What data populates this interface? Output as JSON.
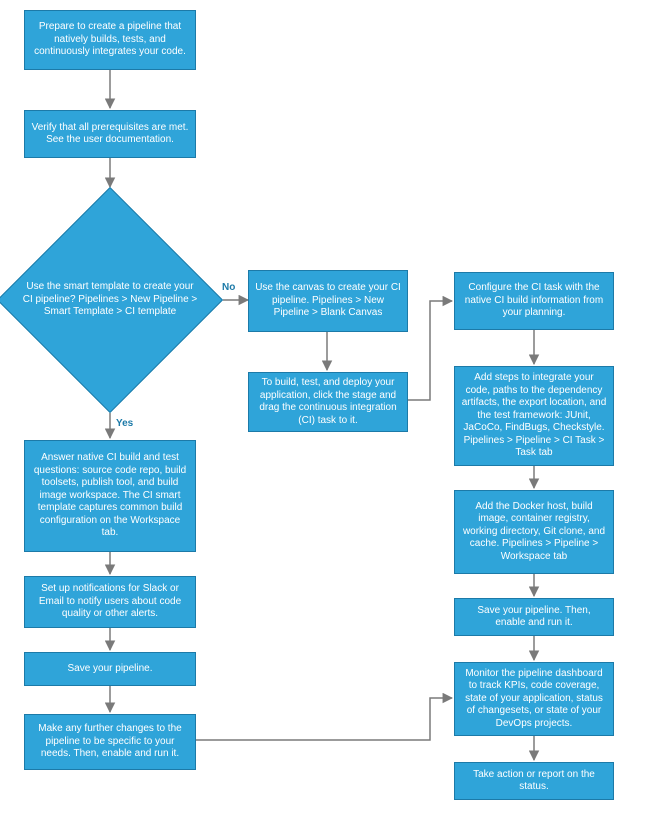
{
  "chart_data": {
    "type": "flowchart",
    "title": "",
    "nodes": [
      {
        "id": "prepare",
        "shape": "rect",
        "text": "Prepare to create a pipeline that natively builds, tests, and continuously integrates your code."
      },
      {
        "id": "verify",
        "shape": "rect",
        "text": "Verify that all prerequisites are met. See the user documentation."
      },
      {
        "id": "decision",
        "shape": "diamond",
        "text": "Use the smart template to create your CI pipeline? Pipelines > New Pipeline > Smart Template > CI template"
      },
      {
        "id": "answer",
        "shape": "rect",
        "text": "Answer native CI build and test questions: source code repo, build toolsets, publish tool, and build image workspace. The CI smart template captures common build configuration on the Workspace tab."
      },
      {
        "id": "notify",
        "shape": "rect",
        "text": "Set up notifications for Slack or Email to notify users about code quality or other alerts."
      },
      {
        "id": "save1",
        "shape": "rect",
        "text": "Save your pipeline."
      },
      {
        "id": "further",
        "shape": "rect",
        "text": "Make any further changes to the pipeline to be specific to your needs. Then, enable and run it."
      },
      {
        "id": "canvas",
        "shape": "rect",
        "text": "Use the canvas to create your CI pipeline. Pipelines > New Pipeline > Blank Canvas"
      },
      {
        "id": "dragtask",
        "shape": "rect",
        "text": "To build, test, and deploy your application, click the stage and drag the continuous integration (CI) task to it."
      },
      {
        "id": "configure",
        "shape": "rect",
        "text": "Configure the CI task with the native CI build information from your planning."
      },
      {
        "id": "steps",
        "shape": "rect",
        "text": "Add steps to integrate your code, paths to the dependency artifacts, the export location, and the test framework: JUnit, JaCoCo, FindBugs, Checkstyle. Pipelines > Pipeline > CI Task > Task tab"
      },
      {
        "id": "docker",
        "shape": "rect",
        "text": "Add the Docker host, build image, container registry, working directory, Git clone, and cache. Pipelines > Pipeline > Workspace tab"
      },
      {
        "id": "save2",
        "shape": "rect",
        "text": "Save your pipeline. Then, enable and run it."
      },
      {
        "id": "monitor",
        "shape": "rect",
        "text": "Monitor the pipeline dashboard to track KPIs, code coverage, state of your application, status of changesets, or state of your DevOps projects."
      },
      {
        "id": "action",
        "shape": "rect",
        "text": "Take action or report on the status."
      }
    ],
    "edges": [
      {
        "from": "prepare",
        "to": "verify",
        "label": ""
      },
      {
        "from": "verify",
        "to": "decision",
        "label": ""
      },
      {
        "from": "decision",
        "to": "answer",
        "label": "Yes"
      },
      {
        "from": "decision",
        "to": "canvas",
        "label": "No"
      },
      {
        "from": "answer",
        "to": "notify",
        "label": ""
      },
      {
        "from": "notify",
        "to": "save1",
        "label": ""
      },
      {
        "from": "save1",
        "to": "further",
        "label": ""
      },
      {
        "from": "canvas",
        "to": "dragtask",
        "label": ""
      },
      {
        "from": "dragtask",
        "to": "configure",
        "label": ""
      },
      {
        "from": "configure",
        "to": "steps",
        "label": ""
      },
      {
        "from": "steps",
        "to": "docker",
        "label": ""
      },
      {
        "from": "docker",
        "to": "save2",
        "label": ""
      },
      {
        "from": "save2",
        "to": "monitor",
        "label": ""
      },
      {
        "from": "monitor",
        "to": "action",
        "label": ""
      },
      {
        "from": "further",
        "to": "monitor",
        "label": ""
      }
    ]
  },
  "labels": {
    "yes": "Yes",
    "no": "No"
  },
  "colors": {
    "node_fill": "#2fa4d9",
    "node_border": "#1c7aa8",
    "text": "#ffffff",
    "arrow": "#7a7a7a"
  }
}
